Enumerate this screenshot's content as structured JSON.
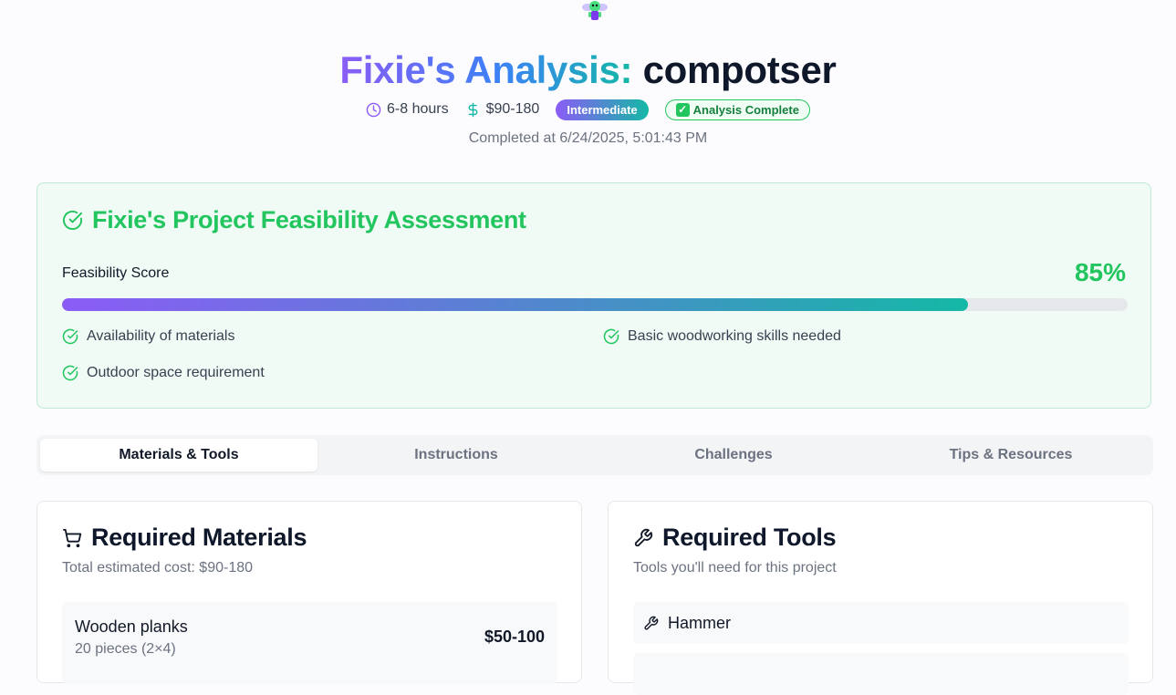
{
  "header": {
    "title_prefix": "Fixie's Analysis:",
    "project_name": "compotser",
    "time_estimate": "6-8 hours",
    "cost_estimate": "$90-180",
    "difficulty": "Intermediate",
    "status": "Analysis Complete",
    "completed_at": "Completed at 6/24/2025, 5:01:43 PM"
  },
  "feasibility": {
    "title": "Fixie's Project Feasibility Assessment",
    "score_label": "Feasibility Score",
    "score_text": "85%",
    "score": 85,
    "factors": [
      "Availability of materials",
      "Basic woodworking skills needed",
      "Outdoor space requirement"
    ]
  },
  "tabs": [
    {
      "label": "Materials & Tools",
      "active": true
    },
    {
      "label": "Instructions",
      "active": false
    },
    {
      "label": "Challenges",
      "active": false
    },
    {
      "label": "Tips & Resources",
      "active": false
    }
  ],
  "materials": {
    "title": "Required Materials",
    "subtitle": "Total estimated cost: $90-180",
    "items": [
      {
        "name": "Wooden planks",
        "quantity": "20 pieces (2×4)",
        "price": "$50-100"
      }
    ]
  },
  "tools": {
    "title": "Required Tools",
    "subtitle": "Tools you'll need for this project",
    "items": [
      "Hammer"
    ]
  },
  "colors": {
    "accent_purple": "#8b5cf6",
    "accent_teal": "#14b8a6",
    "success_green": "#22c55e"
  },
  "icons": {
    "mascot": "fixie-mascot-icon",
    "time": "clock-icon",
    "cost": "dollar-icon",
    "assessment": "check-circle-icon",
    "materials": "shopping-cart-icon",
    "tools": "wrench-icon"
  }
}
